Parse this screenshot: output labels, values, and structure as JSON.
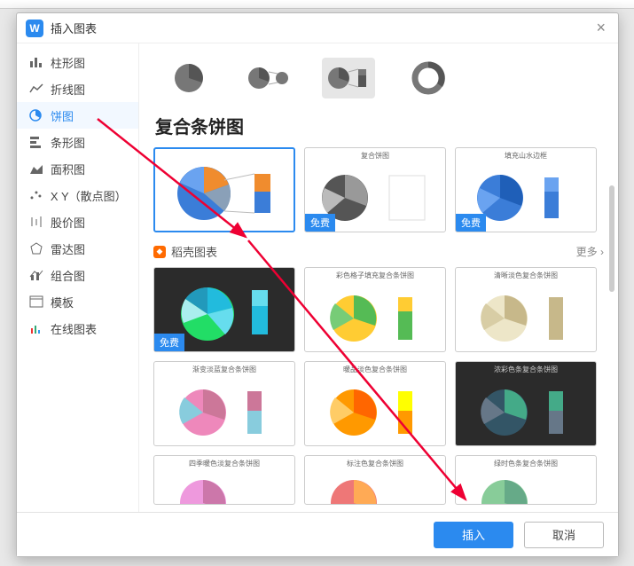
{
  "window": {
    "title": "插入图表",
    "close": "×",
    "app_glyph": "W"
  },
  "sidebar": {
    "items": [
      {
        "label": "柱形图"
      },
      {
        "label": "折线图"
      },
      {
        "label": "饼图"
      },
      {
        "label": "条形图"
      },
      {
        "label": "面积图"
      },
      {
        "label": "X Y（散点图）"
      },
      {
        "label": "股价图"
      },
      {
        "label": "雷达图"
      },
      {
        "label": "组合图"
      },
      {
        "label": "模板"
      },
      {
        "label": "在线图表"
      }
    ]
  },
  "section": {
    "title": "复合条饼图"
  },
  "docer": {
    "title": "稻壳图表",
    "more": "更多 ›"
  },
  "free_tag": "免费",
  "card_titles": {
    "c2": "复合饼图",
    "c3": "填充山水边框",
    "d1": "彩色格子填充复合条饼图",
    "d2": "清晰淡色复合条饼图",
    "e0": "渐变淡蓝复合条饼图",
    "e1": "暖品淡色复合条饼图",
    "e2": "浓彩色条复合条饼图",
    "f0": "四季暖色淡复合条饼图",
    "f1": "标注色复合条饼图",
    "f2": "绿时色条复合条饼图"
  },
  "footer": {
    "insert": "插入",
    "cancel": "取消"
  },
  "chart_data": [
    {
      "type": "pie",
      "title": "复合条饼图缩略",
      "series": [
        {
          "name": "s1",
          "values": [
            35,
            25,
            20,
            20
          ]
        }
      ],
      "legend_position": "right"
    },
    {
      "type": "pie",
      "title": "复合饼图",
      "series": [
        {
          "name": "s1",
          "values": [
            60,
            20,
            12,
            8
          ]
        }
      ]
    },
    {
      "type": "pie",
      "title": "填充山水边框",
      "series": [
        {
          "name": "s1",
          "values": [
            30,
            25,
            15,
            10,
            10,
            10
          ]
        }
      ]
    }
  ]
}
